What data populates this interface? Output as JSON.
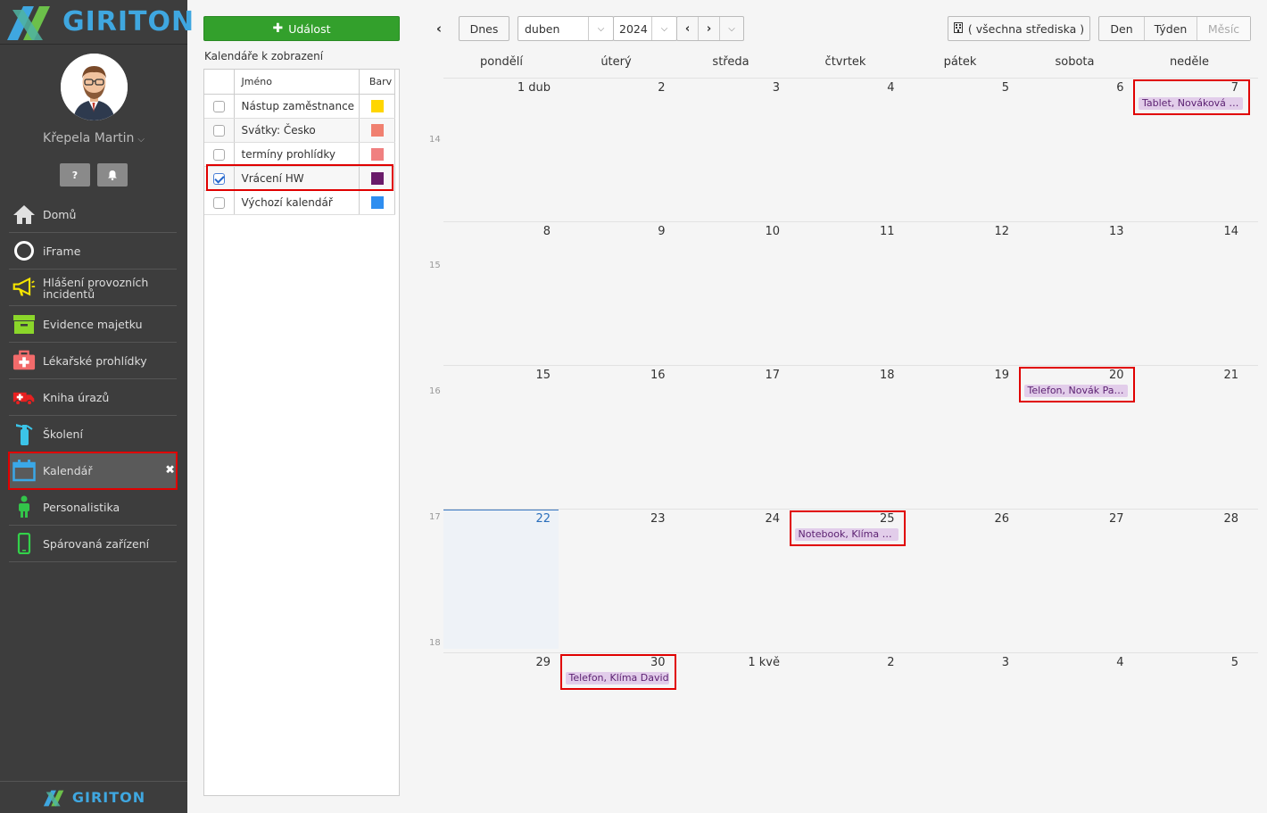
{
  "brand": {
    "name": "GIRITON"
  },
  "user": {
    "name": "Křepela Martin"
  },
  "sidebar": {
    "items": [
      {
        "label": "Domů"
      },
      {
        "label": "iFrame"
      },
      {
        "label": "Hlášení provozních incidentů"
      },
      {
        "label": "Evidence majetku"
      },
      {
        "label": "Lékařské prohlídky"
      },
      {
        "label": "Kniha úrazů"
      },
      {
        "label": "Školení"
      },
      {
        "label": "Kalendář",
        "active": true
      },
      {
        "label": "Personalistika"
      },
      {
        "label": "Spárovaná zařízení"
      }
    ]
  },
  "panel": {
    "new_event_label": "Událost",
    "list_title": "Kalendáře k zobrazení",
    "col_name": "Jméno",
    "col_color": "Barv",
    "calendars": [
      {
        "name": "Nástup zaměstnance",
        "color": "#ffd600",
        "checked": false
      },
      {
        "name": "Svátky: Česko",
        "color": "#f08070",
        "checked": false
      },
      {
        "name": "termíny prohlídky",
        "color": "#f08080",
        "checked": false
      },
      {
        "name": "Vrácení HW",
        "color": "#6a1b6a",
        "checked": true
      },
      {
        "name": "Výchozí kalendář",
        "color": "#2e8ef0",
        "checked": false
      }
    ]
  },
  "toolbar": {
    "today": "Dnes",
    "month": "duben",
    "year": "2024",
    "center": "( všechna střediska )",
    "views": [
      "Den",
      "Týden",
      "Měsíc"
    ]
  },
  "calendar": {
    "weekdays": [
      "pondělí",
      "úterý",
      "středa",
      "čtvrtek",
      "pátek",
      "sobota",
      "neděle"
    ],
    "week_numbers": [
      "14",
      "15",
      "16",
      "17",
      "18"
    ],
    "weeks": [
      [
        "1 dub",
        "2",
        "3",
        "4",
        "5",
        "6",
        "7"
      ],
      [
        "8",
        "9",
        "10",
        "11",
        "12",
        "13",
        "14"
      ],
      [
        "15",
        "16",
        "17",
        "18",
        "19",
        "20",
        "21"
      ],
      [
        "22",
        "23",
        "24",
        "25",
        "26",
        "27",
        "28"
      ],
      [
        "29",
        "30",
        "1 kvě",
        "2",
        "3",
        "4",
        "5"
      ]
    ],
    "today": {
      "week": 3,
      "day": 0
    },
    "events": [
      {
        "week": 0,
        "day": 6,
        "title": "Tablet, Nováková P..."
      },
      {
        "week": 2,
        "day": 5,
        "title": "Telefon, Novák Pavel"
      },
      {
        "week": 3,
        "day": 3,
        "title": "Notebook, Klíma D..."
      },
      {
        "week": 4,
        "day": 1,
        "title": "Telefon, Klíma David"
      }
    ]
  }
}
